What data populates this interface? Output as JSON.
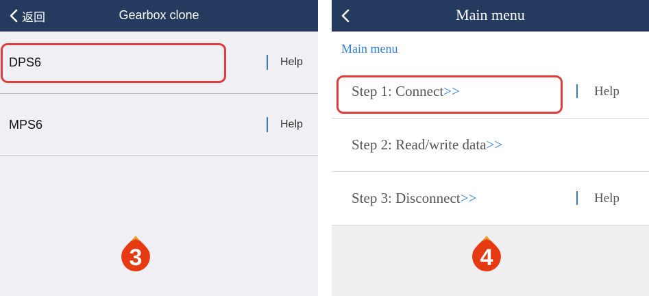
{
  "left": {
    "nav": {
      "back_label": "返回",
      "title": "Gearbox clone"
    },
    "items": [
      {
        "label": "DPS6",
        "help": "Help"
      },
      {
        "label": "MPS6",
        "help": "Help"
      }
    ],
    "step_badge": "3"
  },
  "right": {
    "nav": {
      "title": "Main menu"
    },
    "breadcrumb": "Main menu",
    "steps": [
      {
        "label": "Step 1: Connect",
        "arrow": ">>",
        "help": "Help"
      },
      {
        "label": "Step 2: Read/write data",
        "arrow": ">>"
      },
      {
        "label": "Step 3: Disconnect",
        "arrow": ">>",
        "help": "Help"
      }
    ],
    "step_badge": "4"
  },
  "colors": {
    "navbar": "#243a5e",
    "highlight": "#e23d3d",
    "link_blue": "#2f7dd6",
    "badge": "#e63a12"
  }
}
